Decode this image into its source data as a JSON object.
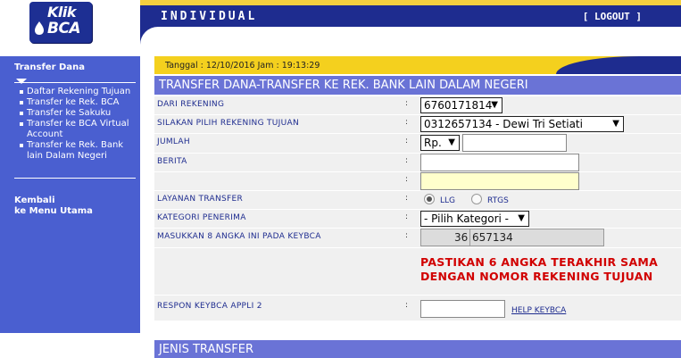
{
  "app": {
    "logo_text_top": "Klik",
    "logo_text_bottom": "BCA",
    "header_title": "INDIVIDUAL",
    "logout_label": "[ LOGOUT ]"
  },
  "sidebar": {
    "title": "Transfer Dana",
    "items": [
      {
        "label": "Daftar Rekening Tujuan"
      },
      {
        "label": "Transfer ke Rek. BCA"
      },
      {
        "label": "Transfer ke Sakuku"
      },
      {
        "label": "Transfer ke BCA Virtual Account"
      },
      {
        "label": "Transfer ke Rek. Bank lain Dalam Negeri"
      }
    ],
    "back_line1": "Kembali",
    "back_line2": "ke Menu Utama"
  },
  "main": {
    "date_text": "Tanggal : 12/10/2016 Jam : 19:13:29",
    "title": "TRANSFER DANA-TRANSFER KE REK. BANK LAIN DALAM NEGERI",
    "form": {
      "dari_rekening_label": "DARI REKENING",
      "dari_rekening_value": "6760171814",
      "rekening_tujuan_label": "SILAKAN PILIH REKENING TUJUAN",
      "rekening_tujuan_value": "0312657134 - Dewi Tri Setiati",
      "jumlah_label": "JUMLAH",
      "currency_value": "Rp.",
      "jumlah_value": "",
      "berita_label": "BERITA",
      "berita_value_1": "",
      "berita_value_2": "",
      "layanan_label": "LAYANAN TRANSFER",
      "layanan_option_1": "LLG",
      "layanan_option_2": "RTGS",
      "layanan_selected": "LLG",
      "kategori_label": "KATEGORI PENERIMA",
      "kategori_value": "- Pilih Kategori -",
      "keybca_label": "MASUKKAN 8 ANGKA INI PADA KEYBCA",
      "keybca_prefix": "36",
      "keybca_value": "657134",
      "warning_text": "PASTIKAN 6 ANGKA TERAKHIR SAMA DENGAN NOMOR REKENING TUJUAN",
      "respon_label": "RESPON KEYBCA APPLI 2",
      "respon_value": "",
      "help_label": "HELP KEYBCA",
      "colon": ":"
    },
    "jenis_title": "JENIS TRANSFER"
  },
  "colors": {
    "header_blue": "#1e2c8f",
    "sidebar_blue": "#4a5fd0",
    "title_bar": "#6a73d6",
    "date_yellow": "#f4d01e",
    "warning_red": "#d10000"
  }
}
